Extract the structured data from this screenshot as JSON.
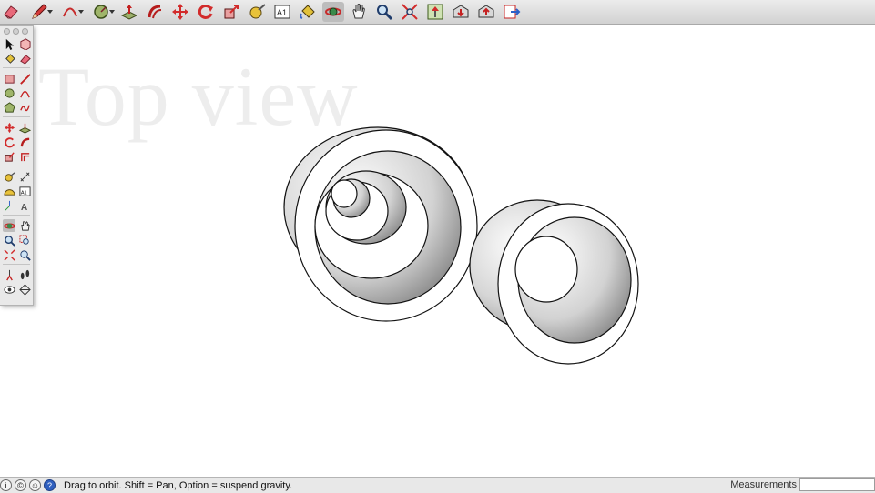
{
  "watermark": "Top view",
  "toolbar": {
    "buttons": [
      {
        "name": "eraser-icon",
        "icon": "eraser"
      },
      {
        "name": "pencil-icon",
        "icon": "pencil",
        "dropdown": true
      },
      {
        "name": "arc-icon",
        "icon": "arc",
        "dropdown": true
      },
      {
        "name": "circle-icon",
        "icon": "circle",
        "dropdown": true
      },
      {
        "name": "push-pull-icon",
        "icon": "push-pull"
      },
      {
        "name": "follow-me-icon",
        "icon": "follow-me"
      },
      {
        "name": "move-icon",
        "icon": "move"
      },
      {
        "name": "rotate-icon",
        "icon": "rotate"
      },
      {
        "name": "scale-icon",
        "icon": "scale"
      },
      {
        "name": "tape-measure-icon",
        "icon": "tape-measure"
      },
      {
        "name": "text-label-icon",
        "icon": "text",
        "label": "A1"
      },
      {
        "name": "paint-bucket-icon",
        "icon": "paint-bucket"
      },
      {
        "name": "orbit-icon",
        "icon": "orbit",
        "active": true
      },
      {
        "name": "pan-icon",
        "icon": "pan"
      },
      {
        "name": "zoom-icon",
        "icon": "zoom"
      },
      {
        "name": "zoom-extents-icon",
        "icon": "zoom-extents"
      },
      {
        "name": "add-location-icon",
        "icon": "add-location"
      },
      {
        "name": "3d-warehouse-get-icon",
        "icon": "warehouse-get"
      },
      {
        "name": "3d-warehouse-share-icon",
        "icon": "warehouse-share"
      },
      {
        "name": "send-to-layout-icon",
        "icon": "send-layout"
      }
    ]
  },
  "palette": {
    "rows": [
      [
        "select-icon",
        "make-component-icon"
      ],
      [
        "paint-bucket-icon",
        "eraser-icon"
      ],
      [
        "rectangle-icon",
        "line-icon"
      ],
      [
        "circle-icon",
        "arc-icon"
      ],
      [
        "polygon-icon",
        "freehand-icon"
      ],
      [
        "move-icon",
        "push-pull-icon"
      ],
      [
        "rotate-icon",
        "follow-me-icon"
      ],
      [
        "scale-icon",
        "offset-icon"
      ],
      [
        "tape-measure-icon",
        "dimension-icon"
      ],
      [
        "protractor-icon",
        "text-icon"
      ],
      [
        "axes-icon",
        "3d-text-icon"
      ],
      [
        "orbit-icon",
        "pan-icon"
      ],
      [
        "zoom-icon",
        "zoom-window-icon"
      ],
      [
        "zoom-extents-icon",
        "previous-view-icon"
      ],
      [
        "position-camera-icon",
        "walk-icon"
      ],
      [
        "look-around-icon",
        "section-plane-icon"
      ]
    ],
    "active": "orbit-icon"
  },
  "statusbar": {
    "message": "Drag to orbit. Shift = Pan, Option = suspend gravity.",
    "help_symbol": "?",
    "measurements_label": "Measurements",
    "measurements_value": ""
  }
}
